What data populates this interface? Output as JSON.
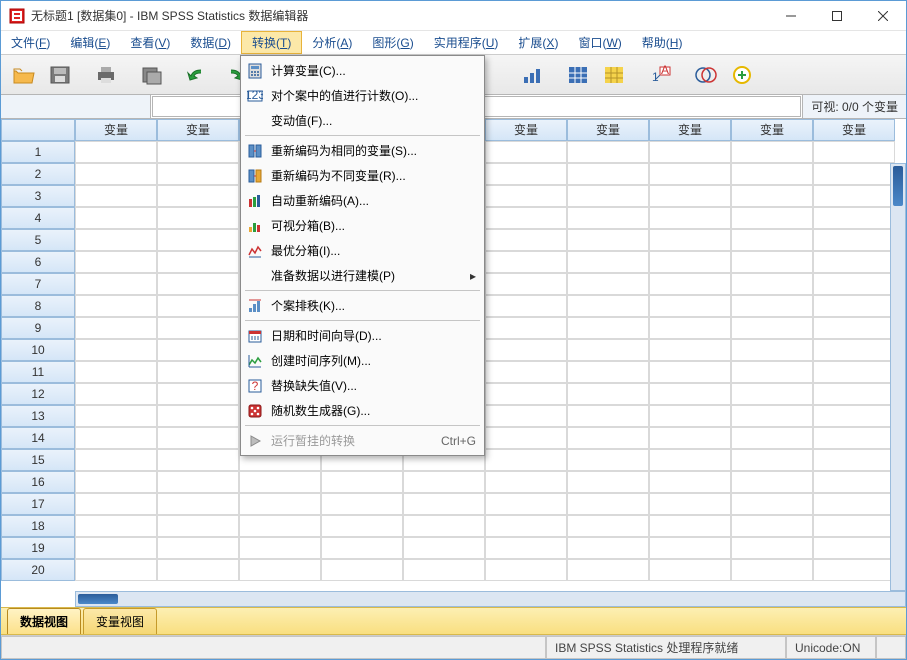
{
  "title": "无标题1 [数据集0] - IBM SPSS Statistics 数据编辑器",
  "menu": {
    "items": [
      {
        "label": "文件",
        "key": "F"
      },
      {
        "label": "编辑",
        "key": "E"
      },
      {
        "label": "查看",
        "key": "V"
      },
      {
        "label": "数据",
        "key": "D"
      },
      {
        "label": "转换",
        "key": "T",
        "active": true
      },
      {
        "label": "分析",
        "key": "A"
      },
      {
        "label": "图形",
        "key": "G"
      },
      {
        "label": "实用程序",
        "key": "U"
      },
      {
        "label": "扩展",
        "key": "X"
      },
      {
        "label": "窗口",
        "key": "W"
      },
      {
        "label": "帮助",
        "key": "H"
      }
    ]
  },
  "dropdown": {
    "items": [
      {
        "label": "计算变量(C)...",
        "icon": "calc"
      },
      {
        "label": "对个案中的值进行计数(O)...",
        "icon": "count"
      },
      {
        "label": "变动值(F)..."
      },
      {
        "sep": true
      },
      {
        "label": "重新编码为相同的变量(S)...",
        "icon": "recode-same"
      },
      {
        "label": "重新编码为不同变量(R)...",
        "icon": "recode-diff"
      },
      {
        "label": "自动重新编码(A)...",
        "icon": "auto-recode"
      },
      {
        "label": "可视分箱(B)...",
        "icon": "visual-bin"
      },
      {
        "label": "最优分箱(I)...",
        "icon": "optimal-bin"
      },
      {
        "label": "准备数据以进行建模(P)",
        "submenu": true
      },
      {
        "sep": true
      },
      {
        "label": "个案排秩(K)...",
        "icon": "rank"
      },
      {
        "sep": true
      },
      {
        "label": "日期和时间向导(D)...",
        "icon": "datetime"
      },
      {
        "label": "创建时间序列(M)...",
        "icon": "timeseries"
      },
      {
        "label": "替换缺失值(V)...",
        "icon": "replace-missing"
      },
      {
        "label": "随机数生成器(G)...",
        "icon": "random"
      },
      {
        "sep": true
      },
      {
        "label": "运行暂挂的转换",
        "icon": "run-pending",
        "shortcut": "Ctrl+G",
        "disabled": true
      }
    ]
  },
  "visible_label": "可视: 0/0 个变量",
  "col_header": "变量",
  "rows": [
    1,
    2,
    3,
    4,
    5,
    6,
    7,
    8,
    9,
    10,
    11,
    12,
    13,
    14,
    15,
    16,
    17,
    18,
    19,
    20
  ],
  "view_tabs": {
    "data": "数据视图",
    "variable": "变量视图"
  },
  "status": {
    "processor": "IBM SPSS Statistics 处理程序就绪",
    "unicode": "Unicode:ON"
  }
}
